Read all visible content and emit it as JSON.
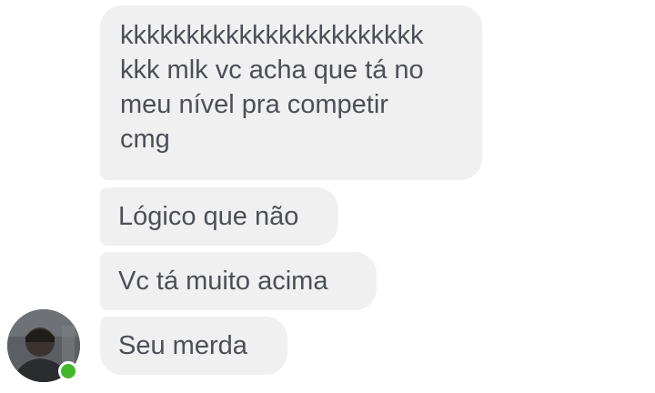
{
  "conversation": {
    "messages": [
      {
        "text": "kkkkkkkkkkkkkkkkkkkkkkk\nkkk mlk vc acha que tá no\nmeu nível pra competir\ncmg"
      },
      {
        "text": "Lógico que não"
      },
      {
        "text": "Vc tá muito acima"
      },
      {
        "text": "Seu merda"
      }
    ],
    "sender": {
      "avatar_icon": "user-avatar",
      "status": "online",
      "status_color": "#42b72a"
    }
  },
  "colors": {
    "bubble_bg": "#f1f0f0",
    "text": "#4b4f56"
  }
}
